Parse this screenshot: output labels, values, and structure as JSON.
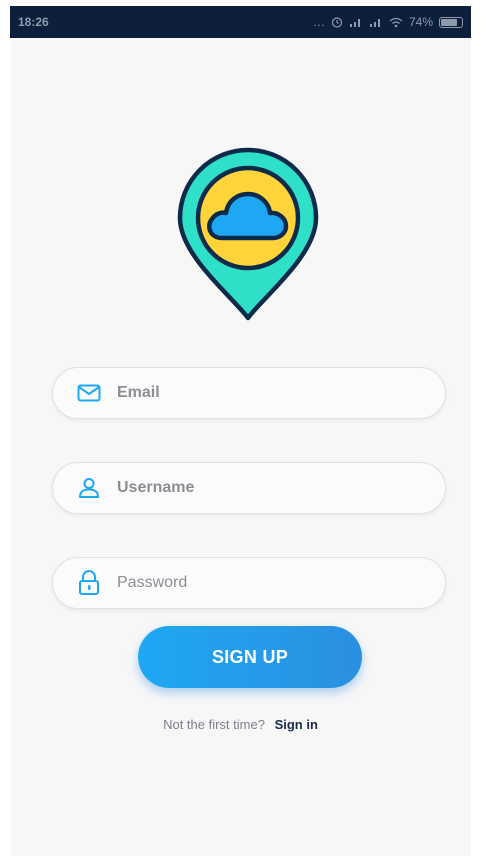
{
  "status_bar": {
    "time": "18:26",
    "battery": "74%"
  },
  "form": {
    "email_placeholder": "Email",
    "username_placeholder": "Username",
    "password_placeholder": "Password",
    "signup_label": "SIGN UP"
  },
  "footer": {
    "prompt": "Not the first time?",
    "signin_label": "Sign in"
  },
  "colors": {
    "status_bar_bg": "#0d1f3c",
    "accent": "#1ea8f3",
    "logo_teal": "#2fe0c9",
    "logo_yellow": "#ffd43b",
    "logo_cloud": "#1ea8f3",
    "logo_outline": "#0d2a4a"
  },
  "icons": {
    "email": "envelope-icon",
    "username": "user-icon",
    "password": "lock-icon",
    "logo": "map-pin-cloud-icon"
  }
}
